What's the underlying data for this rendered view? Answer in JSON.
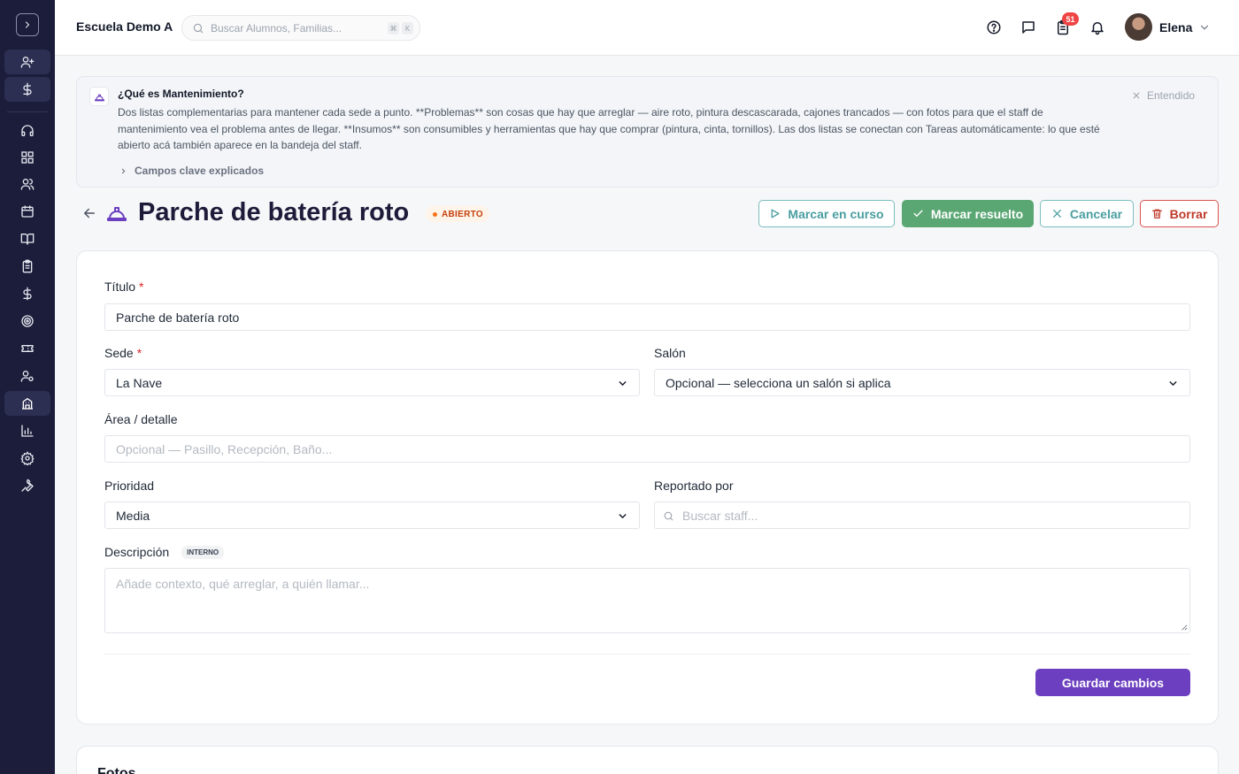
{
  "app": {
    "school_name": "Escuela Demo A",
    "search_placeholder": "Buscar Alumnos, Familias...",
    "search_kbd": [
      "⌘",
      "K"
    ],
    "notifications_count": "51",
    "user_name": "Elena"
  },
  "sidebar": {
    "items": [
      {
        "icon": "user-plus-icon"
      },
      {
        "icon": "dollar-icon"
      },
      {
        "icon": "headset-icon"
      },
      {
        "icon": "grid-icon"
      },
      {
        "icon": "users-icon"
      },
      {
        "icon": "calendar-icon"
      },
      {
        "icon": "book-open-icon"
      },
      {
        "icon": "clipboard-icon"
      },
      {
        "icon": "dollar-icon"
      },
      {
        "icon": "target-icon"
      },
      {
        "icon": "ticket-icon"
      },
      {
        "icon": "user-gear-icon"
      },
      {
        "icon": "building-icon",
        "active": true
      },
      {
        "icon": "bar-chart-icon"
      },
      {
        "icon": "gear-icon"
      },
      {
        "icon": "wrench-icon"
      }
    ]
  },
  "info": {
    "title": "¿Qué es Mantenimiento?",
    "body": "Dos listas complementarias para mantener cada sede a punto. **Problemas** son cosas que hay que arreglar — aire roto, pintura descascarada, cajones trancados — con fotos para que el staff de mantenimiento vea el problema antes de llegar. **Insumos** son consumibles y herramientas que hay que comprar (pintura, cinta, tornillos). Las dos listas se conectan con Tareas automáticamente: lo que esté abierto acá también aparece en la bandeja del staff.",
    "dismiss_label": "Entendido",
    "fields_link": "Campos clave explicados"
  },
  "page": {
    "title": "Parche de batería roto",
    "status": "ABIERTO",
    "actions": {
      "in_progress": "Marcar en curso",
      "resolve": "Marcar resuelto",
      "cancel": "Cancelar",
      "delete": "Borrar"
    }
  },
  "form": {
    "title_label": "Título",
    "title_value": "Parche de batería roto",
    "site_label": "Sede",
    "site_value": "La Nave",
    "room_label": "Salón",
    "room_value": "Opcional — selecciona un salón si aplica",
    "area_label": "Área / detalle",
    "area_placeholder": "Opcional — Pasillo, Recepción, Baño...",
    "priority_label": "Prioridad",
    "priority_value": "Media",
    "reporter_label": "Reportado por",
    "reporter_placeholder": "Buscar staff...",
    "description_label": "Descripción",
    "description_tag": "INTERNO",
    "description_placeholder": "Añade contexto, qué arreglar, a quién llamar...",
    "save_label": "Guardar cambios"
  },
  "photos": {
    "title": "Fotos"
  },
  "colors": {
    "sidebar_bg": "#1b1d3a",
    "accent_purple": "#6b3fbf",
    "teal": "#4a9ea0",
    "green": "#5aa774",
    "danger": "#c0392b",
    "status_orange": "#f97316"
  }
}
